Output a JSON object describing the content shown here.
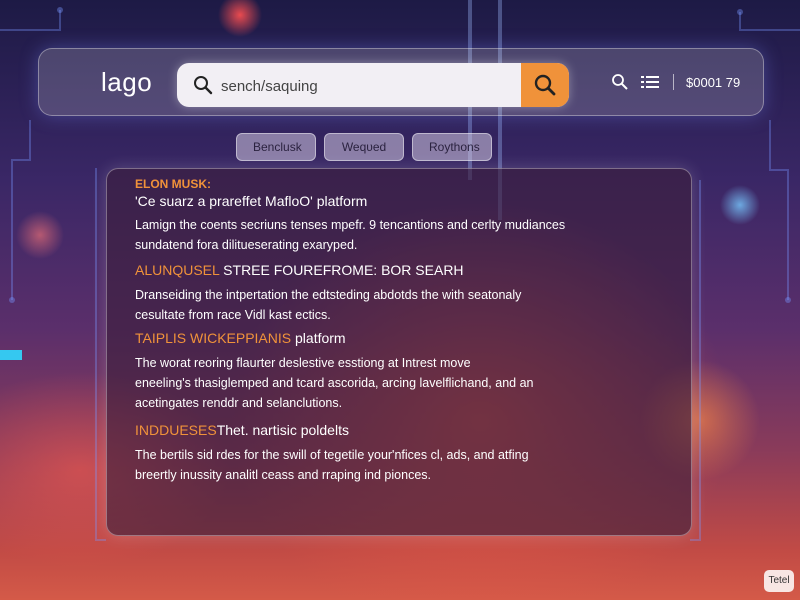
{
  "header": {
    "logo_text": "lago",
    "search": {
      "placeholder": "sench/saquing",
      "value": ""
    },
    "balance": "$0001 79"
  },
  "tabs": [
    {
      "label": "Benclusk"
    },
    {
      "label": "Weqυed"
    },
    {
      "label": "Roythons"
    }
  ],
  "results": [
    {
      "brand": "ELON MUSK:",
      "title": "'Ce suarz a prareffet MafloO' platform",
      "desc_lines": [
        "Lamign the coents secriuns tenses mpefr. 9 tencantions and cerlty mudiances",
        "sundatend fora dilitueserating exaryped."
      ]
    },
    {
      "title_highlight": "ALUNQUSEL",
      "title_rest": " STREE FOUREFROME: BOR SEARH",
      "desc_lines": [
        "Dranseiding the intpertation the edtsteding abdotds the with seatonaly",
        "cesultate from race Vidl kast ectics."
      ]
    },
    {
      "title_highlight": "TAIPLIS WICKEPPIANIS",
      "title_rest": " platform",
      "desc_lines": [
        "The worat reoring flaurter deslestive esstiong at Intrest move",
        "eneeling's thasiglemped and tcard ascorida, arcing lavelflichand, and an",
        "acetingates renddr and selanclutions."
      ]
    },
    {
      "title_highlight": "INDDUESES",
      "title_rest": "Thet. nartisic poldelts",
      "desc_lines": [
        "The bertils sid rdes for the swill of tegetile your'nfices cl, ads, and atfing",
        "breertly inussity analitl ceass and rraping ind pionces."
      ]
    }
  ],
  "corner_badge": "Tetel",
  "colors": {
    "accent": "#f0923a",
    "panel": "#3c1e3c"
  }
}
